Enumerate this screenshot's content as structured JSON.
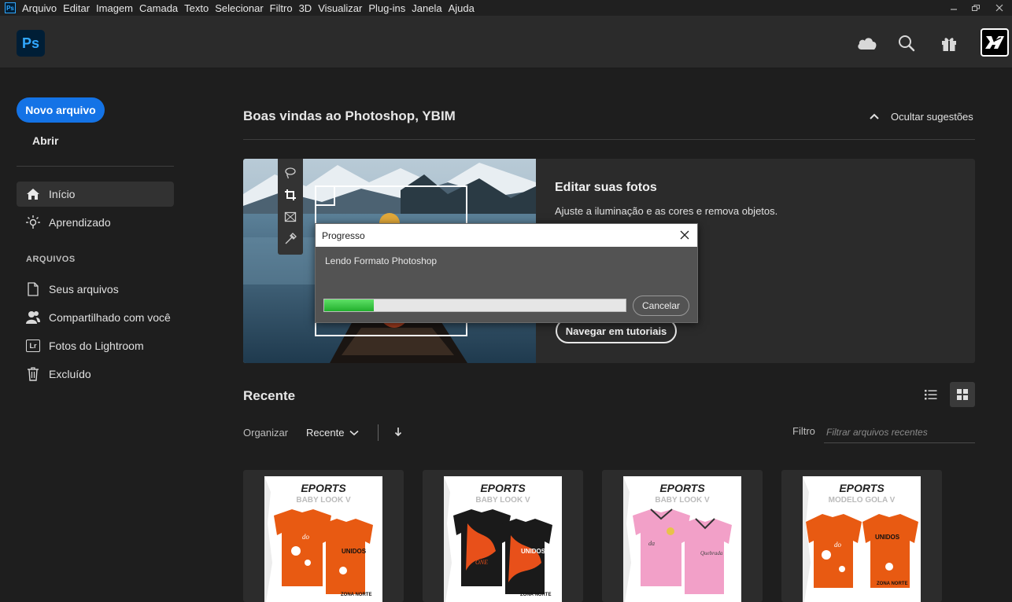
{
  "menubar": {
    "items": [
      "Arquivo",
      "Editar",
      "Imagem",
      "Camada",
      "Texto",
      "Selecionar",
      "Filtro",
      "3D",
      "Visualizar",
      "Plug-ins",
      "Janela",
      "Ajuda"
    ],
    "app_icon": "Ps"
  },
  "header": {
    "logo": "Ps",
    "icons": [
      "cloud-icon",
      "search-icon",
      "gift-icon"
    ]
  },
  "sidebar": {
    "new_file": "Novo arquivo",
    "open": "Abrir",
    "nav": [
      {
        "label": "Início",
        "icon": "home-icon",
        "active": true
      },
      {
        "label": "Aprendizado",
        "icon": "lightbulb-icon",
        "active": false
      }
    ],
    "files_section": "ARQUIVOS",
    "files": [
      {
        "label": "Seus arquivos",
        "icon": "file-icon"
      },
      {
        "label": "Compartilhado com você",
        "icon": "shared-users-icon"
      },
      {
        "label": "Fotos do Lightroom",
        "icon": "lightroom-icon",
        "badge": "Lr"
      },
      {
        "label": "Excluído",
        "icon": "trash-icon"
      }
    ]
  },
  "main": {
    "welcome": "Boas vindas ao Photoshop, YBIM",
    "hide_suggestions": "Ocultar sugestões",
    "card": {
      "title": "Editar suas fotos",
      "description": "Ajuste a iluminação e as cores e remova objetos.",
      "button": "Navegar em tutoriais"
    },
    "recent": {
      "title": "Recente",
      "organize": "Organizar",
      "sort": "Recente",
      "filter_label": "Filtro",
      "filter_placeholder": "Filtrar arquivos recentes",
      "view_mode": "grid",
      "thumbnails": [
        {
          "title": "EPORTS",
          "subtitle": "BABY LOOK V",
          "base": "#e85a12",
          "accent": "#ffffff"
        },
        {
          "title": "EPORTS",
          "subtitle": "BABY LOOK V",
          "base": "#1a1a1a",
          "accent": "#e8501a"
        },
        {
          "title": "EPORTS",
          "subtitle": "BABY LOOK V",
          "base": "#f2a0c8",
          "accent": "#ffffff"
        },
        {
          "title": "EPORTS",
          "subtitle": "MODELO GOLA V",
          "base": "#e85a12",
          "accent": "#ffffff"
        }
      ]
    }
  },
  "dialog": {
    "title": "Progresso",
    "message": "Lendo Formato Photoshop",
    "progress": 0.165,
    "cancel": "Cancelar"
  },
  "colors": {
    "accent": "#1473e6",
    "progress": "#2cbf37",
    "ps_blue": "#31a8ff"
  }
}
